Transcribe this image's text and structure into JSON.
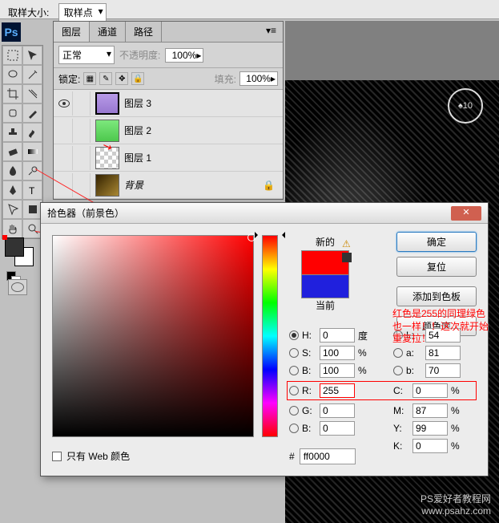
{
  "topbar": {
    "sample_label": "取样大小:",
    "sample_value": "取样点"
  },
  "app": {
    "icon": "Ps"
  },
  "panels": {
    "tabs": [
      "图层",
      "通道",
      "路径"
    ],
    "blend_mode": "正常",
    "opacity_label": "不透明度:",
    "opacity_value": "100%",
    "lock_label": "锁定:",
    "fill_label": "填充:",
    "fill_value": "100%"
  },
  "layers": [
    {
      "name": "图层 3",
      "visible": true,
      "active": true,
      "thumb": "purple checker"
    },
    {
      "name": "图层 2",
      "visible": false,
      "thumb": "green checker"
    },
    {
      "name": "图层 1",
      "visible": false,
      "thumb": "checker"
    },
    {
      "name": "背景",
      "visible": false,
      "italic": true,
      "locked": true,
      "thumb": "bg"
    }
  ],
  "canvas": {
    "card_value": "♠10"
  },
  "picker": {
    "title": "拾色器（前景色）",
    "new_label": "新的",
    "current_label": "当前",
    "buttons": {
      "ok": "确定",
      "cancel": "复位",
      "add": "添加到色板",
      "lib": "颜色库"
    },
    "fields": {
      "H": {
        "label": "H:",
        "value": "0",
        "unit": "度"
      },
      "S": {
        "label": "S:",
        "value": "100",
        "unit": "%"
      },
      "Bv": {
        "label": "B:",
        "value": "100",
        "unit": "%"
      },
      "R": {
        "label": "R:",
        "value": "255",
        "unit": ""
      },
      "G": {
        "label": "G:",
        "value": "0",
        "unit": ""
      },
      "Bb": {
        "label": "B:",
        "value": "0",
        "unit": ""
      },
      "L": {
        "label": "L:",
        "value": "54",
        "unit": ""
      },
      "a": {
        "label": "a:",
        "value": "81",
        "unit": ""
      },
      "b": {
        "label": "b:",
        "value": "70",
        "unit": ""
      },
      "C": {
        "label": "C:",
        "value": "0",
        "unit": "%"
      },
      "M": {
        "label": "M:",
        "value": "87",
        "unit": "%"
      },
      "Y": {
        "label": "Y:",
        "value": "99",
        "unit": "%"
      },
      "K": {
        "label": "K:",
        "value": "0",
        "unit": "%"
      }
    },
    "hex_label": "#",
    "hex_value": "ff0000",
    "web_only": "只有 Web 颜色"
  },
  "annotation": "红色是255的同理绿色也一样！！这次就开始重复拉！",
  "watermark": {
    "line1": "PS爱好者教程网",
    "line2": "www.psahz.com"
  }
}
